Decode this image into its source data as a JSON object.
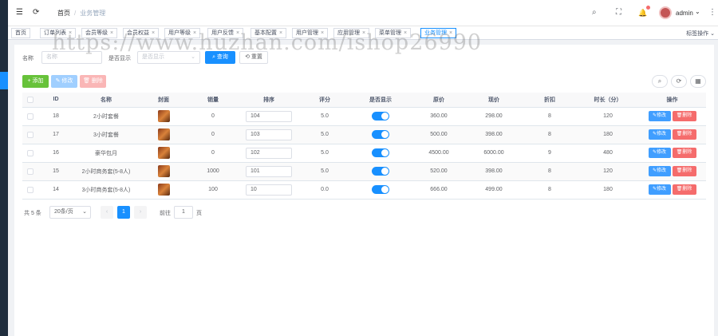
{
  "navbar": {
    "menu_icon": "☰",
    "refresh_icon": "⟳",
    "breadcrumb": {
      "home": "首页",
      "separator": "/",
      "current": "业务管理"
    },
    "search_icon": "⌕",
    "fullscreen_icon": "⛶",
    "bell_icon": "🔔",
    "username": "admin",
    "user_chevron": "⌄",
    "more_icon": "⋮"
  },
  "tags": [
    {
      "label": "首页",
      "closable": false
    },
    {
      "label": "订单列表",
      "closable": true
    },
    {
      "label": "会员等级",
      "closable": true
    },
    {
      "label": "会员权益",
      "closable": true
    },
    {
      "label": "用户等级",
      "closable": true
    },
    {
      "label": "用户反馈",
      "closable": true
    },
    {
      "label": "基本配置",
      "closable": true
    },
    {
      "label": "用户管理",
      "closable": true
    },
    {
      "label": "应用管理",
      "closable": true
    },
    {
      "label": "菜单管理",
      "closable": true
    },
    {
      "label": "业务管理",
      "closable": true,
      "active": true
    }
  ],
  "tag_close": "×",
  "tags_more": "标签操作 ⌄",
  "search": {
    "name_label": "名称",
    "name_placeholder": "名称",
    "status_label": "是否显示",
    "status_placeholder": "是否显示",
    "query_button": "⌕ 查询",
    "reset_button": "⟲ 重置"
  },
  "toolbar": {
    "add": "+ 添加",
    "edit": "✎ 修改",
    "delete": "🗑 删除",
    "search_toggle": "⌕",
    "refresh": "⟳",
    "columns": "▦"
  },
  "table": {
    "headers": [
      "",
      "ID",
      "名称",
      "封面",
      "销量",
      "排序",
      "评分",
      "是否显示",
      "原价",
      "现价",
      "折扣",
      "时长（分）",
      "操作"
    ],
    "rows": [
      {
        "id": "18",
        "name": "2小时套餐",
        "sales": "0",
        "sort": "104",
        "score": "5.0",
        "price": "360.00",
        "current": "298.00",
        "discount": "8",
        "duration": "120"
      },
      {
        "id": "17",
        "name": "3小时套餐",
        "sales": "0",
        "sort": "103",
        "score": "5.0",
        "price": "500.00",
        "current": "398.00",
        "discount": "8",
        "duration": "180"
      },
      {
        "id": "16",
        "name": "豪华包月",
        "sales": "0",
        "sort": "102",
        "score": "5.0",
        "price": "4500.00",
        "current": "6000.00",
        "discount": "9",
        "duration": "480"
      },
      {
        "id": "15",
        "name": "2小时商务套(5-8人)",
        "sales": "1000",
        "sort": "101",
        "score": "5.0",
        "price": "520.00",
        "current": "398.00",
        "discount": "8",
        "duration": "120"
      },
      {
        "id": "14",
        "name": "3小时商务套(5-8人)",
        "sales": "100",
        "sort": "10",
        "score": "0.0",
        "price": "666.00",
        "current": "499.00",
        "discount": "8",
        "duration": "180"
      }
    ],
    "edit_label": "✎修改",
    "delete_label": "🗑删除"
  },
  "pager": {
    "total": "共 5 条",
    "page_size": "20条/页",
    "prev": "‹",
    "current_page": "1",
    "next": "›",
    "goto_label": "前往",
    "goto_value": "1",
    "page_suffix": "页"
  },
  "watermark": "https://www.huzhan.com/ishop26990",
  "colors": {
    "primary": "#1890ff",
    "success": "#67c23a",
    "danger": "#f56c6c",
    "sidebar": "#1f2d3d"
  }
}
